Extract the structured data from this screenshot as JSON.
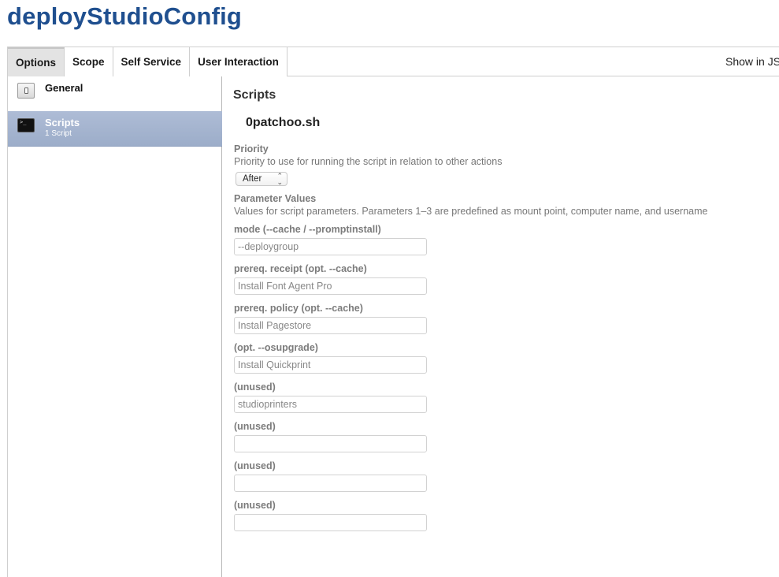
{
  "page": {
    "title": "deployStudioConfig"
  },
  "tabs": [
    {
      "label": "Options",
      "active": true
    },
    {
      "label": "Scope",
      "active": false
    },
    {
      "label": "Self Service",
      "active": false
    },
    {
      "label": "User Interaction",
      "active": false
    }
  ],
  "header_right": {
    "show_in_label": "Show in JSS"
  },
  "sidebar": {
    "items": [
      {
        "label": "General",
        "icon": "general-icon",
        "sublabel": ""
      },
      {
        "label": "Scripts",
        "icon": "terminal-icon",
        "sublabel": "1 Script",
        "selected": true
      }
    ]
  },
  "main": {
    "section_title": "Scripts",
    "script_name": "0patchoo.sh",
    "priority": {
      "label": "Priority",
      "description": "Priority to use for running the script in relation to other actions",
      "value": "After"
    },
    "parameters": {
      "label": "Parameter Values",
      "description": "Values for script parameters. Parameters 1–3 are predefined as mount point, computer name, and username",
      "fields": [
        {
          "label": "mode (--cache / --promptinstall)",
          "value": "--deploygroup"
        },
        {
          "label": "prereq. receipt (opt. --cache)",
          "value": "Install Font Agent Pro"
        },
        {
          "label": "prereq. policy (opt. --cache)",
          "value": "Install Pagestore"
        },
        {
          "label": "(opt. --osupgrade)",
          "value": "Install Quickprint"
        },
        {
          "label": "(unused)",
          "value": "studioprinters"
        },
        {
          "label": "(unused)",
          "value": ""
        },
        {
          "label": "(unused)",
          "value": ""
        },
        {
          "label": "(unused)",
          "value": ""
        }
      ]
    }
  },
  "colors": {
    "title_blue": "#1f4f8f",
    "selected_sidebar": "#a6b5d0",
    "label_gray": "#7c7c7c"
  }
}
